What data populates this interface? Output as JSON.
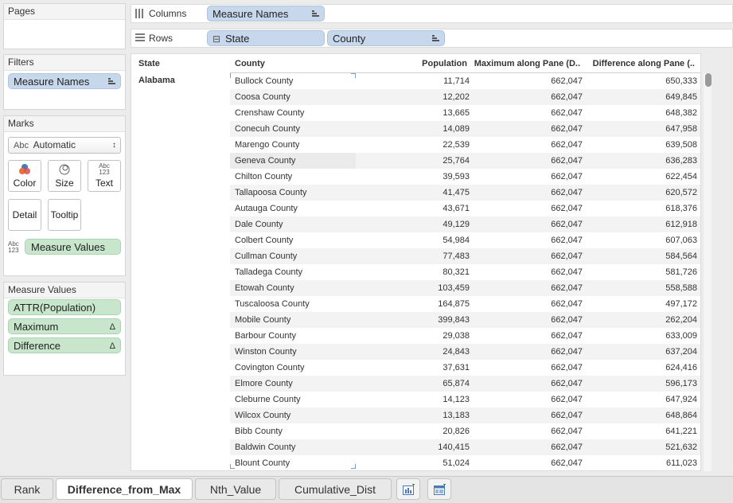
{
  "cards": {
    "pages": "Pages",
    "filters": "Filters",
    "marks": "Marks",
    "measure_values": "Measure Values"
  },
  "filters": {
    "pill": "Measure Names"
  },
  "marks": {
    "mark_type_prefix": "Abc",
    "mark_type": "Automatic",
    "buttons": {
      "color": "Color",
      "size": "Size",
      "text": "Text",
      "detail": "Detail",
      "tooltip": "Tooltip"
    },
    "text_icon_top": "Abc",
    "text_icon_bottom": "123",
    "text_field": "Measure Values"
  },
  "measure_values": {
    "items": [
      {
        "label": "ATTR(Population)",
        "delta": ""
      },
      {
        "label": "Maximum",
        "delta": "Δ"
      },
      {
        "label": "Difference",
        "delta": "Δ"
      }
    ]
  },
  "shelves": {
    "columns_label": "Columns",
    "columns_pill": "Measure Names",
    "rows_label": "Rows",
    "rows_pills": [
      "State",
      "County"
    ],
    "state_prefix": "⊟"
  },
  "view": {
    "headers": {
      "state": "State",
      "county": "County",
      "population": "Population",
      "maximum": "Maximum along Pane (D..",
      "difference": "Difference along Pane (.."
    },
    "state_value": "Alabama",
    "rows": [
      {
        "county": "Bullock County",
        "population": "11,714",
        "maximum": "662,047",
        "difference": "650,333"
      },
      {
        "county": "Coosa County",
        "population": "12,202",
        "maximum": "662,047",
        "difference": "649,845"
      },
      {
        "county": "Crenshaw County",
        "population": "13,665",
        "maximum": "662,047",
        "difference": "648,382"
      },
      {
        "county": "Conecuh County",
        "population": "14,089",
        "maximum": "662,047",
        "difference": "647,958"
      },
      {
        "county": "Marengo County",
        "population": "22,539",
        "maximum": "662,047",
        "difference": "639,508"
      },
      {
        "county": "Geneva County",
        "population": "25,764",
        "maximum": "662,047",
        "difference": "636,283"
      },
      {
        "county": "Chilton County",
        "population": "39,593",
        "maximum": "662,047",
        "difference": "622,454"
      },
      {
        "county": "Tallapoosa County",
        "population": "41,475",
        "maximum": "662,047",
        "difference": "620,572"
      },
      {
        "county": "Autauga County",
        "population": "43,671",
        "maximum": "662,047",
        "difference": "618,376"
      },
      {
        "county": "Dale County",
        "population": "49,129",
        "maximum": "662,047",
        "difference": "612,918"
      },
      {
        "county": "Colbert County",
        "population": "54,984",
        "maximum": "662,047",
        "difference": "607,063"
      },
      {
        "county": "Cullman County",
        "population": "77,483",
        "maximum": "662,047",
        "difference": "584,564"
      },
      {
        "county": "Talladega County",
        "population": "80,321",
        "maximum": "662,047",
        "difference": "581,726"
      },
      {
        "county": "Etowah County",
        "population": "103,459",
        "maximum": "662,047",
        "difference": "558,588"
      },
      {
        "county": "Tuscaloosa County",
        "population": "164,875",
        "maximum": "662,047",
        "difference": "497,172"
      },
      {
        "county": "Mobile County",
        "population": "399,843",
        "maximum": "662,047",
        "difference": "262,204"
      },
      {
        "county": "Barbour County",
        "population": "29,038",
        "maximum": "662,047",
        "difference": "633,009"
      },
      {
        "county": "Winston County",
        "population": "24,843",
        "maximum": "662,047",
        "difference": "637,204"
      },
      {
        "county": "Covington County",
        "population": "37,631",
        "maximum": "662,047",
        "difference": "624,416"
      },
      {
        "county": "Elmore County",
        "population": "65,874",
        "maximum": "662,047",
        "difference": "596,173"
      },
      {
        "county": "Cleburne County",
        "population": "14,123",
        "maximum": "662,047",
        "difference": "647,924"
      },
      {
        "county": "Wilcox County",
        "population": "13,183",
        "maximum": "662,047",
        "difference": "648,864"
      },
      {
        "county": "Bibb County",
        "population": "20,826",
        "maximum": "662,047",
        "difference": "641,221"
      },
      {
        "county": "Baldwin County",
        "population": "140,415",
        "maximum": "662,047",
        "difference": "521,632"
      },
      {
        "county": "Blount County",
        "population": "51,024",
        "maximum": "662,047",
        "difference": "611,023"
      }
    ]
  },
  "tabs": [
    {
      "label": "Rank",
      "active": false
    },
    {
      "label": "Difference_from_Max",
      "active": true
    },
    {
      "label": "Nth_Value",
      "active": false
    },
    {
      "label": "Cumulative_Dist",
      "active": false
    }
  ],
  "colors": {
    "blue_pill": "#c7d7ec",
    "green_pill": "#c7e6cc",
    "color_icon_orange": "#e8703a",
    "color_icon_blue": "#4a78b8"
  }
}
